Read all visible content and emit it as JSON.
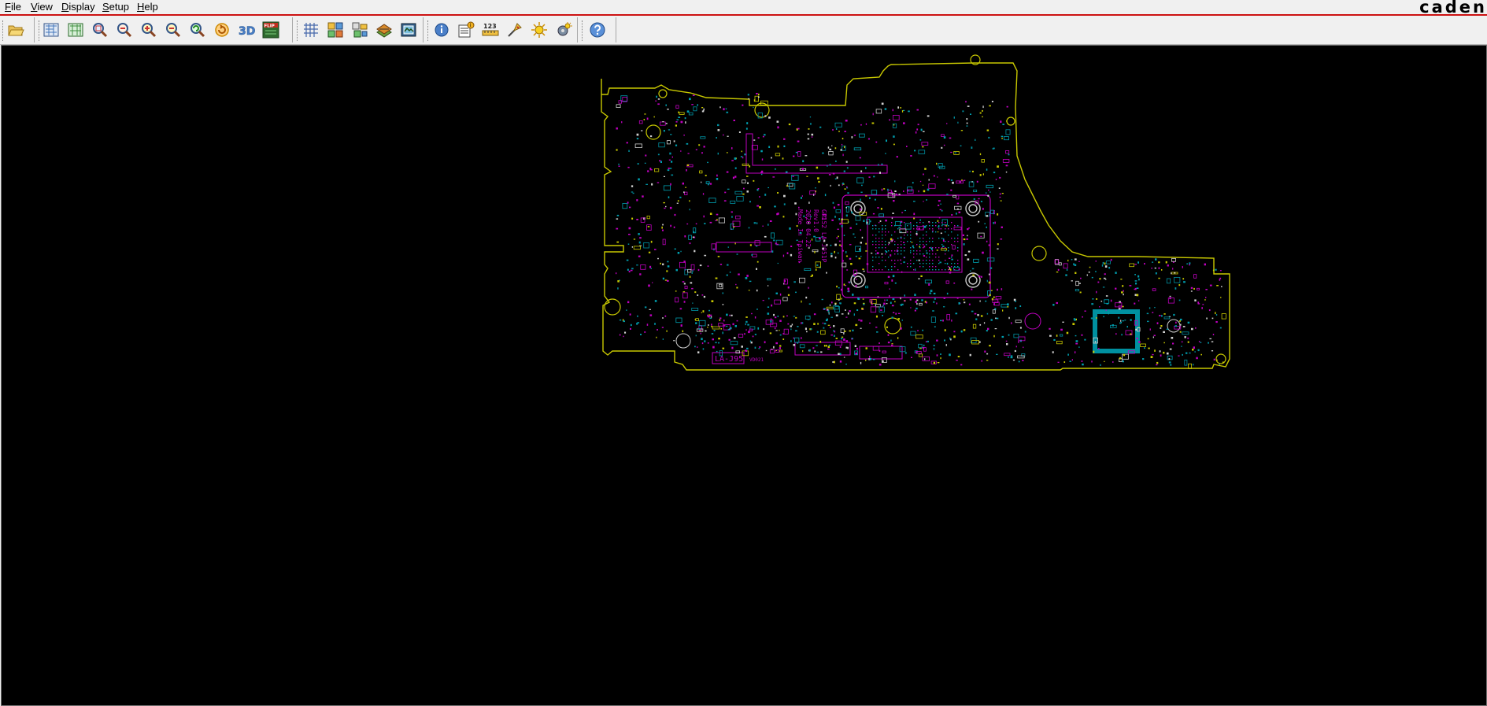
{
  "brand": "caden",
  "menu": [
    {
      "mnemonic": "F",
      "rest": "ile"
    },
    {
      "mnemonic": "V",
      "rest": "iew"
    },
    {
      "mnemonic": "D",
      "rest": "isplay"
    },
    {
      "mnemonic": "S",
      "rest": "etup"
    },
    {
      "mnemonic": "H",
      "rest": "elp"
    }
  ],
  "toolbar": {
    "groups": [
      [
        "open-folder"
      ],
      [
        "board-top-view",
        "board-bottom-view",
        "zoom-area",
        "zoom-fit",
        "zoom-in",
        "zoom-out",
        "zoom-previous",
        "rotate",
        "view-3d",
        "flip-board"
      ],
      [
        "grid",
        "layers",
        "net-highlight",
        "components",
        "board-view"
      ],
      [
        "info",
        "properties",
        "measure",
        "probe",
        "highlight-color",
        "highlight-settings"
      ],
      [
        "help"
      ]
    ],
    "view_3d_label": "3D",
    "flip_label": "FLIP",
    "measure_label": "123"
  },
  "colors": {
    "outline": "#c8c800",
    "silkscreen": "#c000c0",
    "pads": "#00a0b0",
    "menu_underline": "#cc1111",
    "canvas": "#000000"
  },
  "board": {
    "silk_text_vertical": [
      "GP152 LA-J951P",
      "Rev1.0",
      "2020 04.22",
      "Made In Taiwan"
    ],
    "label_bottom_left": "LA-J95",
    "label_bottom_small": "VD021"
  }
}
